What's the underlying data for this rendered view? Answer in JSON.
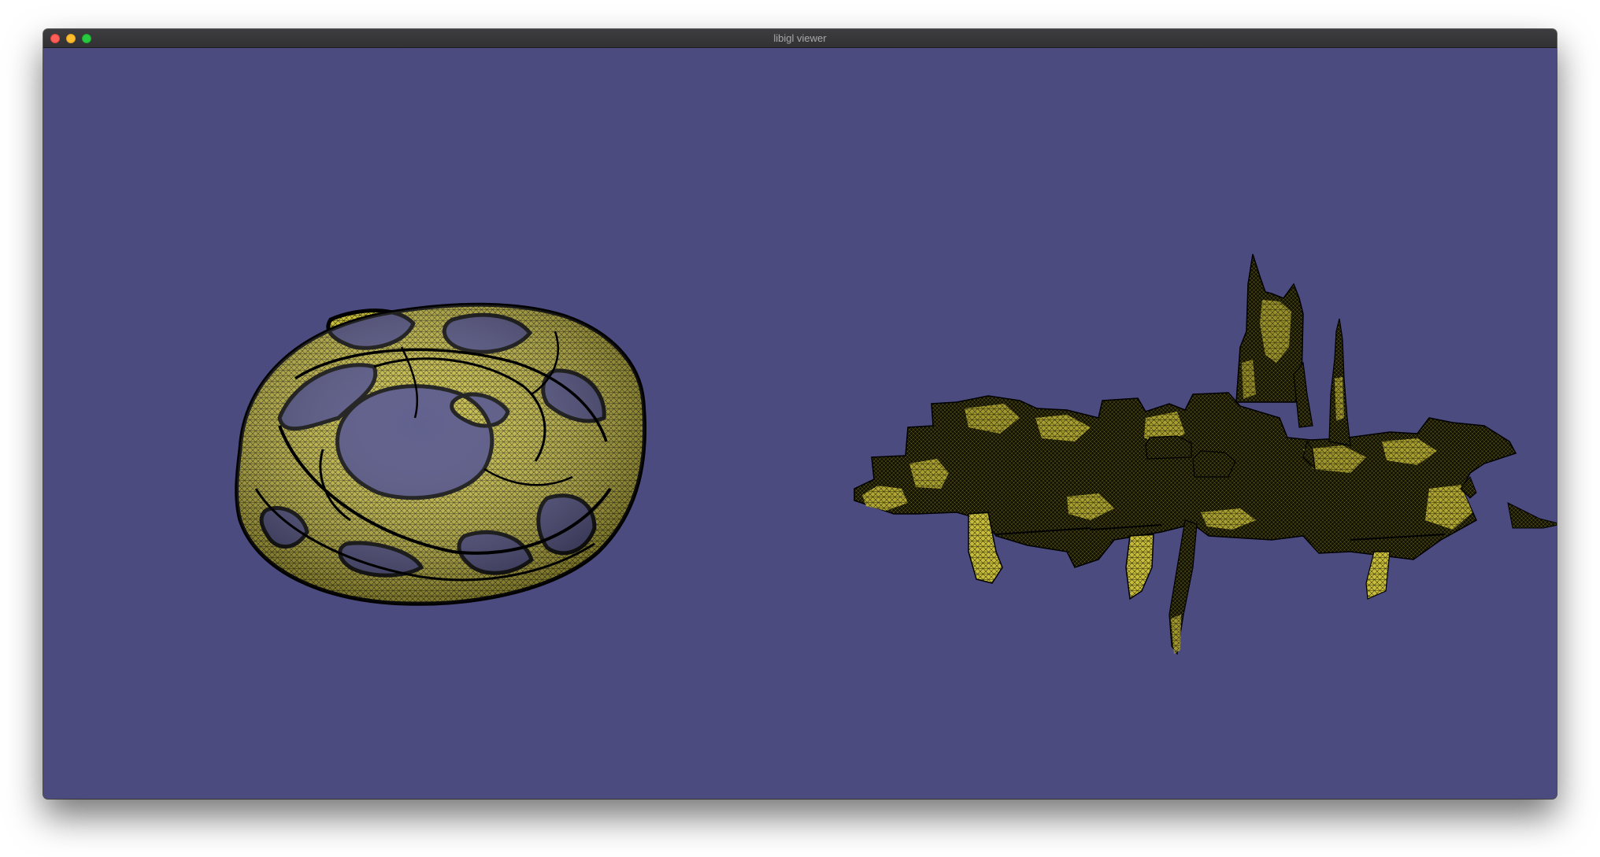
{
  "window": {
    "title": "libigl viewer",
    "background_color": "#4c4b7f"
  },
  "titlebar": {
    "close_icon": "close-icon",
    "minimize_icon": "minimize-icon",
    "zoom_icon": "zoom-icon"
  },
  "viewport": {
    "meshes": [
      {
        "name": "twisted-ring-mesh",
        "color": "#c8bd3a",
        "wire_color": "#000000"
      },
      {
        "name": "city-skyline-mesh",
        "color": "#c8bd3a",
        "wire_color": "#000000"
      }
    ]
  }
}
